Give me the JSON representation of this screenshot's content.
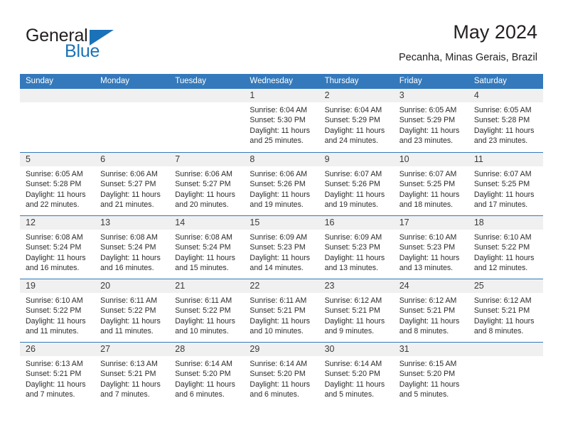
{
  "brand": {
    "name_primary": "General",
    "name_secondary": "Blue",
    "primary_color": "#231f20",
    "secondary_color": "#1b72b8"
  },
  "header": {
    "title": "May 2024",
    "subtitle": "Pecanha, Minas Gerais, Brazil"
  },
  "colors": {
    "header_blue": "#3479bb",
    "day_band_gray": "#f0f0f0",
    "text": "#2b2b2b"
  },
  "weekdays": [
    "Sunday",
    "Monday",
    "Tuesday",
    "Wednesday",
    "Thursday",
    "Friday",
    "Saturday"
  ],
  "weeks": [
    [
      {
        "day": "",
        "lines": [
          "",
          "",
          "",
          ""
        ]
      },
      {
        "day": "",
        "lines": [
          "",
          "",
          "",
          ""
        ]
      },
      {
        "day": "",
        "lines": [
          "",
          "",
          "",
          ""
        ]
      },
      {
        "day": "1",
        "lines": [
          "Sunrise: 6:04 AM",
          "Sunset: 5:30 PM",
          "Daylight: 11 hours",
          "and 25 minutes."
        ]
      },
      {
        "day": "2",
        "lines": [
          "Sunrise: 6:04 AM",
          "Sunset: 5:29 PM",
          "Daylight: 11 hours",
          "and 24 minutes."
        ]
      },
      {
        "day": "3",
        "lines": [
          "Sunrise: 6:05 AM",
          "Sunset: 5:29 PM",
          "Daylight: 11 hours",
          "and 23 minutes."
        ]
      },
      {
        "day": "4",
        "lines": [
          "Sunrise: 6:05 AM",
          "Sunset: 5:28 PM",
          "Daylight: 11 hours",
          "and 23 minutes."
        ]
      }
    ],
    [
      {
        "day": "5",
        "lines": [
          "Sunrise: 6:05 AM",
          "Sunset: 5:28 PM",
          "Daylight: 11 hours",
          "and 22 minutes."
        ]
      },
      {
        "day": "6",
        "lines": [
          "Sunrise: 6:06 AM",
          "Sunset: 5:27 PM",
          "Daylight: 11 hours",
          "and 21 minutes."
        ]
      },
      {
        "day": "7",
        "lines": [
          "Sunrise: 6:06 AM",
          "Sunset: 5:27 PM",
          "Daylight: 11 hours",
          "and 20 minutes."
        ]
      },
      {
        "day": "8",
        "lines": [
          "Sunrise: 6:06 AM",
          "Sunset: 5:26 PM",
          "Daylight: 11 hours",
          "and 19 minutes."
        ]
      },
      {
        "day": "9",
        "lines": [
          "Sunrise: 6:07 AM",
          "Sunset: 5:26 PM",
          "Daylight: 11 hours",
          "and 19 minutes."
        ]
      },
      {
        "day": "10",
        "lines": [
          "Sunrise: 6:07 AM",
          "Sunset: 5:25 PM",
          "Daylight: 11 hours",
          "and 18 minutes."
        ]
      },
      {
        "day": "11",
        "lines": [
          "Sunrise: 6:07 AM",
          "Sunset: 5:25 PM",
          "Daylight: 11 hours",
          "and 17 minutes."
        ]
      }
    ],
    [
      {
        "day": "12",
        "lines": [
          "Sunrise: 6:08 AM",
          "Sunset: 5:24 PM",
          "Daylight: 11 hours",
          "and 16 minutes."
        ]
      },
      {
        "day": "13",
        "lines": [
          "Sunrise: 6:08 AM",
          "Sunset: 5:24 PM",
          "Daylight: 11 hours",
          "and 16 minutes."
        ]
      },
      {
        "day": "14",
        "lines": [
          "Sunrise: 6:08 AM",
          "Sunset: 5:24 PM",
          "Daylight: 11 hours",
          "and 15 minutes."
        ]
      },
      {
        "day": "15",
        "lines": [
          "Sunrise: 6:09 AM",
          "Sunset: 5:23 PM",
          "Daylight: 11 hours",
          "and 14 minutes."
        ]
      },
      {
        "day": "16",
        "lines": [
          "Sunrise: 6:09 AM",
          "Sunset: 5:23 PM",
          "Daylight: 11 hours",
          "and 13 minutes."
        ]
      },
      {
        "day": "17",
        "lines": [
          "Sunrise: 6:10 AM",
          "Sunset: 5:23 PM",
          "Daylight: 11 hours",
          "and 13 minutes."
        ]
      },
      {
        "day": "18",
        "lines": [
          "Sunrise: 6:10 AM",
          "Sunset: 5:22 PM",
          "Daylight: 11 hours",
          "and 12 minutes."
        ]
      }
    ],
    [
      {
        "day": "19",
        "lines": [
          "Sunrise: 6:10 AM",
          "Sunset: 5:22 PM",
          "Daylight: 11 hours",
          "and 11 minutes."
        ]
      },
      {
        "day": "20",
        "lines": [
          "Sunrise: 6:11 AM",
          "Sunset: 5:22 PM",
          "Daylight: 11 hours",
          "and 11 minutes."
        ]
      },
      {
        "day": "21",
        "lines": [
          "Sunrise: 6:11 AM",
          "Sunset: 5:22 PM",
          "Daylight: 11 hours",
          "and 10 minutes."
        ]
      },
      {
        "day": "22",
        "lines": [
          "Sunrise: 6:11 AM",
          "Sunset: 5:21 PM",
          "Daylight: 11 hours",
          "and 10 minutes."
        ]
      },
      {
        "day": "23",
        "lines": [
          "Sunrise: 6:12 AM",
          "Sunset: 5:21 PM",
          "Daylight: 11 hours",
          "and 9 minutes."
        ]
      },
      {
        "day": "24",
        "lines": [
          "Sunrise: 6:12 AM",
          "Sunset: 5:21 PM",
          "Daylight: 11 hours",
          "and 8 minutes."
        ]
      },
      {
        "day": "25",
        "lines": [
          "Sunrise: 6:12 AM",
          "Sunset: 5:21 PM",
          "Daylight: 11 hours",
          "and 8 minutes."
        ]
      }
    ],
    [
      {
        "day": "26",
        "lines": [
          "Sunrise: 6:13 AM",
          "Sunset: 5:21 PM",
          "Daylight: 11 hours",
          "and 7 minutes."
        ]
      },
      {
        "day": "27",
        "lines": [
          "Sunrise: 6:13 AM",
          "Sunset: 5:21 PM",
          "Daylight: 11 hours",
          "and 7 minutes."
        ]
      },
      {
        "day": "28",
        "lines": [
          "Sunrise: 6:14 AM",
          "Sunset: 5:20 PM",
          "Daylight: 11 hours",
          "and 6 minutes."
        ]
      },
      {
        "day": "29",
        "lines": [
          "Sunrise: 6:14 AM",
          "Sunset: 5:20 PM",
          "Daylight: 11 hours",
          "and 6 minutes."
        ]
      },
      {
        "day": "30",
        "lines": [
          "Sunrise: 6:14 AM",
          "Sunset: 5:20 PM",
          "Daylight: 11 hours",
          "and 5 minutes."
        ]
      },
      {
        "day": "31",
        "lines": [
          "Sunrise: 6:15 AM",
          "Sunset: 5:20 PM",
          "Daylight: 11 hours",
          "and 5 minutes."
        ]
      },
      {
        "day": "",
        "lines": [
          "",
          "",
          "",
          ""
        ]
      }
    ]
  ]
}
